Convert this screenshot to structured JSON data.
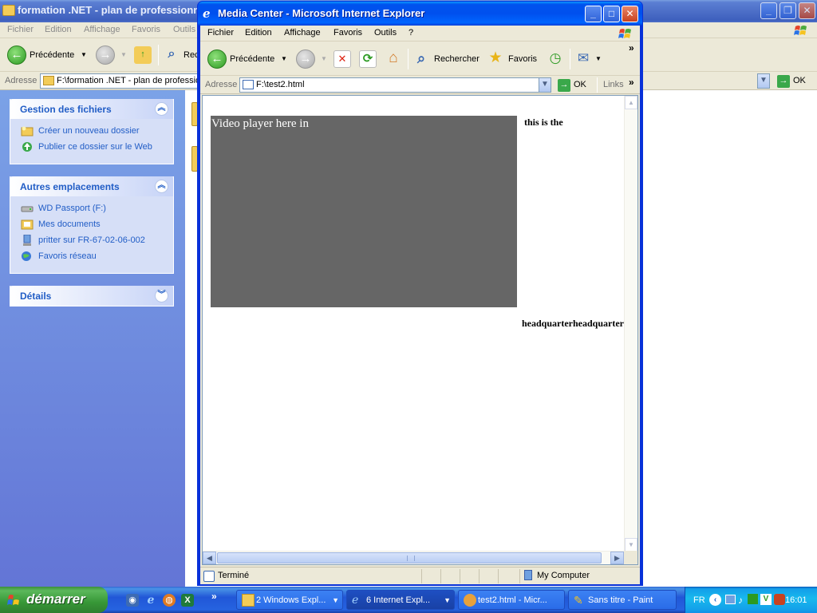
{
  "bg_window": {
    "title": "formation .NET - plan de professionn",
    "menu": [
      "Fichier",
      "Edition",
      "Affichage",
      "Favoris",
      "Outils"
    ],
    "back_label": "Précédente",
    "search_partial": "Rec",
    "address_label": "Adresse",
    "address_value": "F:\\formation .NET - plan de professio",
    "go_label": "OK"
  },
  "taskpane": {
    "panels": [
      {
        "title": "Gestion des fichiers",
        "items": [
          "Créer un nouveau dossier",
          "Publier ce dossier sur le Web"
        ]
      },
      {
        "title": "Autres emplacements",
        "items": [
          "WD Passport (F:)",
          "Mes documents",
          "pritter sur  FR-67-02-06-002",
          "Favoris réseau"
        ]
      },
      {
        "title": "Détails",
        "items": []
      }
    ]
  },
  "ie": {
    "title": "Media Center - Microsoft Internet Explorer",
    "menu": [
      "Fichier",
      "Edition",
      "Affichage",
      "Favoris",
      "Outils",
      "?"
    ],
    "toolbar": {
      "back": "Précédente",
      "search": "Rechercher",
      "favorites": "Favoris"
    },
    "address_label": "Adresse",
    "address_value": "F:\\test2.html",
    "go_label": "OK",
    "links_label": "Links",
    "chevron": "»",
    "page": {
      "video_text": "Video player here in",
      "side_text": "this is the",
      "bottom_text": "headquarterheadquarterheadquarter"
    },
    "status": {
      "left": "Terminé",
      "zone": "My Computer"
    }
  },
  "taskbar": {
    "start_label": "démarrer",
    "tasks": [
      {
        "label": "2 Windows Expl...",
        "active": false
      },
      {
        "label": "6 Internet Expl...",
        "active": true
      },
      {
        "label": "test2.html - Micr...",
        "active": false
      },
      {
        "label": "Sans titre - Paint",
        "active": false
      }
    ],
    "lang": "FR",
    "time": "16:01"
  },
  "colors": {
    "xp_blue": "#0054e3",
    "video_bg": "#666666",
    "taskpane_link": "#215dc6"
  }
}
